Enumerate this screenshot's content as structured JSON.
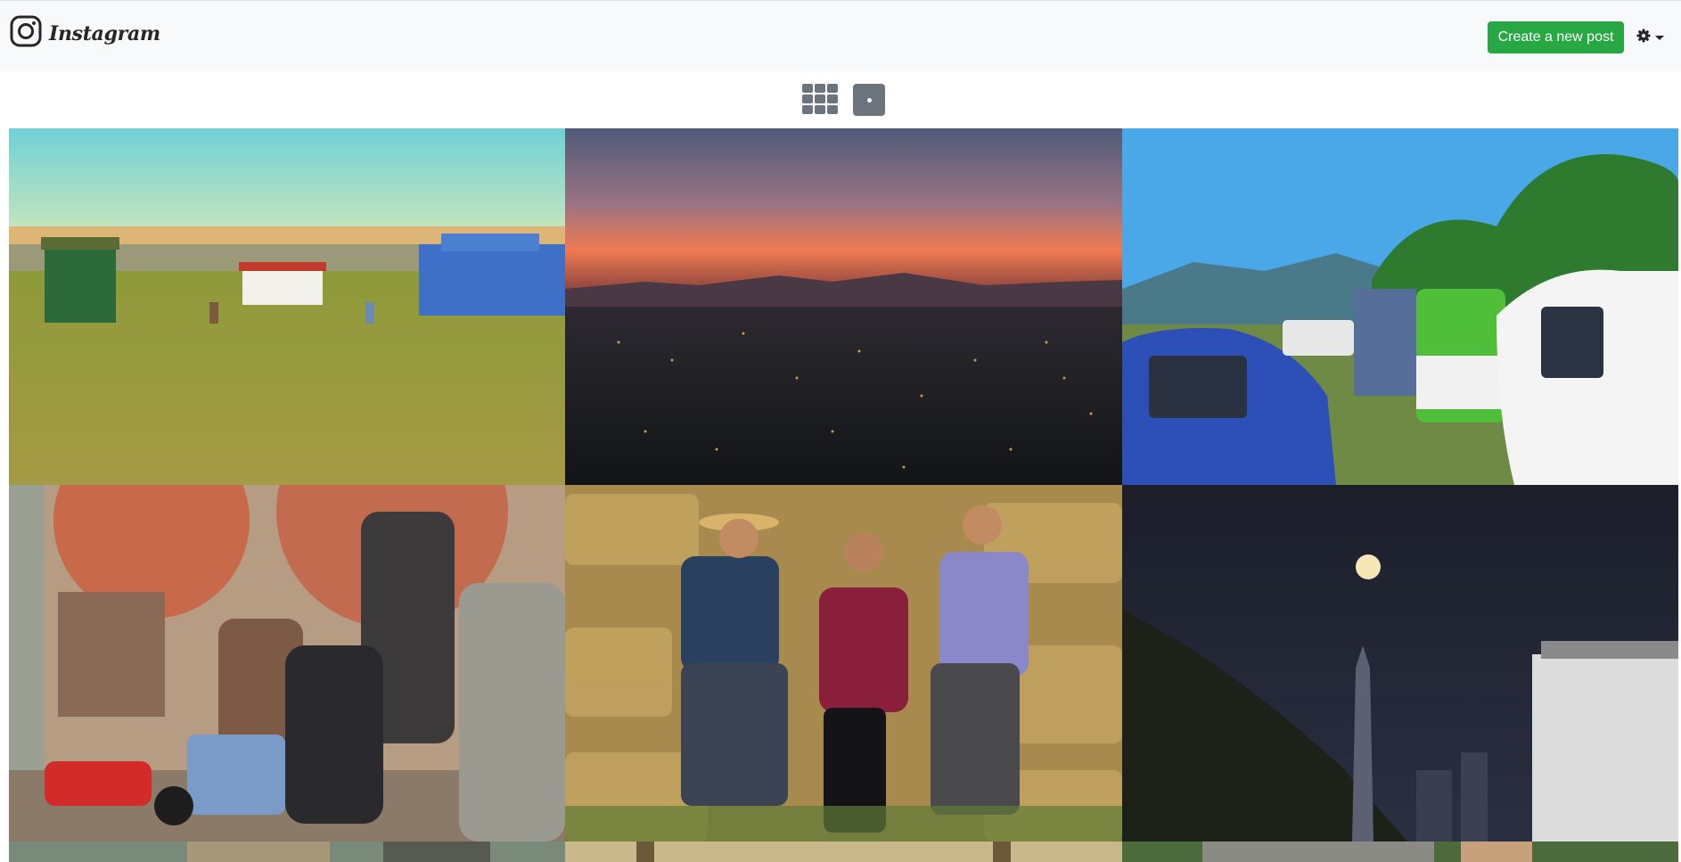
{
  "navbar": {
    "brand_name": "Instagram",
    "create_button_label": "Create a new post",
    "settings_icon": "gear-icon",
    "colors": {
      "background": "#f8f9fa",
      "create_button": "#28a745"
    }
  },
  "view_toggle": {
    "grid_icon": "grid-icon",
    "single_icon": "square-icon",
    "active_color": "#6c757d"
  },
  "feed": {
    "posts": [
      {
        "subject": "two kids walking on a grass field toward blue houses and dunes"
      },
      {
        "subject": "city lights at dusk with a sunset over mountains"
      },
      {
        "subject": "man walking between parked cars and a green and white van"
      },
      {
        "subject": "group of photographers crouching with cameras and a cat"
      },
      {
        "subject": "three smiling people sitting on hay bales"
      },
      {
        "subject": "full moon over a hill and a tall tower at night"
      },
      {
        "subject": "partially visible photo"
      },
      {
        "subject": "partially visible photo"
      },
      {
        "subject": "partially visible photo"
      }
    ]
  }
}
